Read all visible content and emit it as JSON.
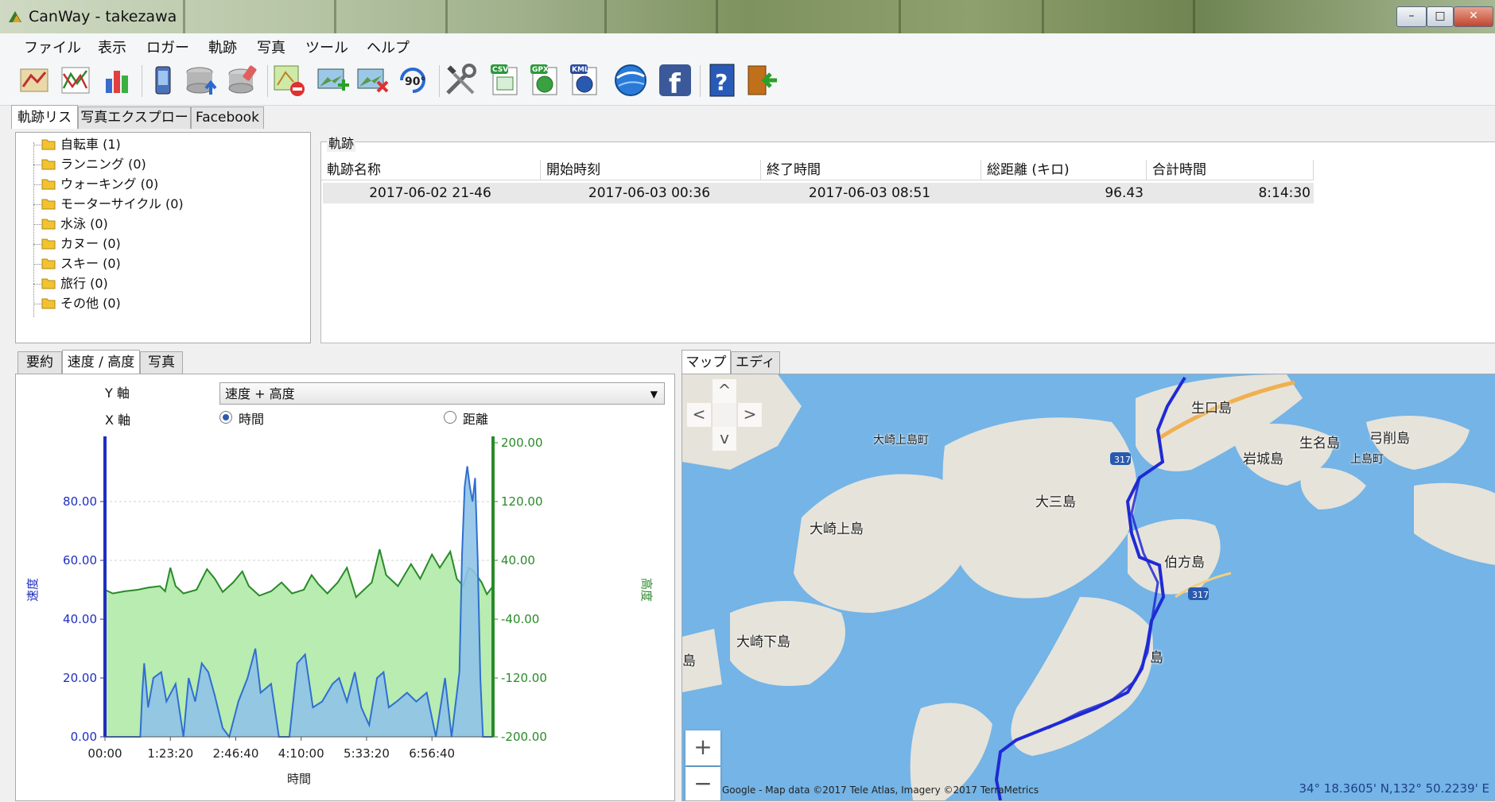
{
  "window": {
    "title": "CanWay - takezawa",
    "min": "–",
    "max": "□",
    "close": "✕"
  },
  "menu": [
    "ファイル",
    "表示",
    "ロガー",
    "軌跡",
    "写真",
    "ツール",
    "ヘルプ"
  ],
  "toolbar_icons": [
    "map-icon",
    "graph-icon",
    "bar-chart-icon",
    "device-icon",
    "database-upload-icon",
    "eraser-icon",
    "delete-track-icon",
    "add-photo-icon",
    "remove-photo-icon",
    "rotate-90-icon",
    "tools-icon",
    "csv-icon",
    "gpx-icon",
    "kml-icon",
    "google-earth-icon",
    "facebook-icon",
    "help-icon",
    "exit-icon"
  ],
  "toolbar": {
    "rotate_text": "90°",
    "csv": "CSV",
    "gpx": "GPX",
    "kml": "KML",
    "facebook": "f",
    "help": "?"
  },
  "top_tabs": [
    "軌跡リスト",
    "写真エクスプローラ",
    "Facebook"
  ],
  "tree": [
    {
      "label": "自転車 (1)"
    },
    {
      "label": "ランニング (0)"
    },
    {
      "label": "ウォーキング (0)"
    },
    {
      "label": "モーターサイクル (0)"
    },
    {
      "label": "水泳 (0)"
    },
    {
      "label": "カヌー (0)"
    },
    {
      "label": "スキー (0)"
    },
    {
      "label": "旅行 (0)"
    },
    {
      "label": "その他 (0)"
    }
  ],
  "tracks": {
    "group_label": "軌跡",
    "columns": [
      "軌跡名称",
      "開始時刻",
      "終了時間",
      "総距離 (キロ)",
      "合計時間"
    ],
    "rows": [
      [
        "2017-06-02 21-46",
        "2017-06-03 00:36",
        "2017-06-03 08:51",
        "96.43",
        "8:14:30"
      ]
    ]
  },
  "bottom_left_tabs": [
    "要約",
    "速度 / 高度",
    "写真"
  ],
  "bottom_right_tabs": [
    "マップ",
    "エディタ"
  ],
  "chart_controls": {
    "y_label": "Y 軸",
    "x_label": "X 軸",
    "y_select": "速度 + 高度",
    "x_option_time": "時間",
    "x_option_distance": "距離"
  },
  "chart_data": {
    "type": "area",
    "x_ticks": [
      "00:00",
      "1:23:20",
      "2:46:40",
      "4:10:00",
      "5:33:20",
      "6:56:40"
    ],
    "xlabel": "時間",
    "y_left": {
      "label": "速度",
      "ticks": [
        "0.00",
        "20.00",
        "40.00",
        "60.00",
        "80.00"
      ],
      "range": [
        0,
        100
      ],
      "color": "#1f2fbf"
    },
    "y_right": {
      "label": "高度",
      "ticks": [
        "-200.00",
        "-120.00",
        "-40.00",
        "40.00",
        "120.00",
        "200.00"
      ],
      "range": [
        -200,
        200
      ],
      "color": "#2a8a2a"
    },
    "x_max_seconds": 29670,
    "series": [
      {
        "name": "高度",
        "axis": "right",
        "color": "#2a8a2a",
        "fill": "#b8ecb0",
        "points": [
          [
            0,
            0
          ],
          [
            600,
            -5
          ],
          [
            1500,
            -2
          ],
          [
            2500,
            0
          ],
          [
            3300,
            3
          ],
          [
            4200,
            5
          ],
          [
            4600,
            -2
          ],
          [
            5000,
            30
          ],
          [
            5400,
            5
          ],
          [
            6000,
            -5
          ],
          [
            7000,
            0
          ],
          [
            7800,
            28
          ],
          [
            8400,
            15
          ],
          [
            9000,
            -3
          ],
          [
            9800,
            10
          ],
          [
            10500,
            25
          ],
          [
            11000,
            5
          ],
          [
            11800,
            -8
          ],
          [
            12700,
            -2
          ],
          [
            13500,
            10
          ],
          [
            14300,
            -5
          ],
          [
            15200,
            0
          ],
          [
            15800,
            20
          ],
          [
            16300,
            8
          ],
          [
            17000,
            -5
          ],
          [
            17800,
            10
          ],
          [
            18500,
            30
          ],
          [
            19200,
            -10
          ],
          [
            20400,
            10
          ],
          [
            21000,
            55
          ],
          [
            21500,
            20
          ],
          [
            22400,
            5
          ],
          [
            23400,
            35
          ],
          [
            24100,
            15
          ],
          [
            25000,
            48
          ],
          [
            25600,
            30
          ],
          [
            26400,
            52
          ],
          [
            26900,
            15
          ],
          [
            27400,
            5
          ],
          [
            27800,
            30
          ],
          [
            28200,
            25
          ],
          [
            28800,
            10
          ],
          [
            29200,
            -6
          ],
          [
            29670,
            5
          ]
        ]
      },
      {
        "name": "速度",
        "axis": "left",
        "color": "#2f6fd0",
        "fill": "#8fc3e8",
        "points": [
          [
            0,
            0
          ],
          [
            2000,
            0
          ],
          [
            2700,
            0
          ],
          [
            2850,
            15
          ],
          [
            3000,
            25
          ],
          [
            3300,
            10
          ],
          [
            3700,
            20
          ],
          [
            4300,
            22
          ],
          [
            4700,
            12
          ],
          [
            5400,
            18
          ],
          [
            6000,
            0
          ],
          [
            6400,
            20
          ],
          [
            6900,
            12
          ],
          [
            7400,
            25
          ],
          [
            7900,
            22
          ],
          [
            8400,
            14
          ],
          [
            9000,
            3
          ],
          [
            9500,
            0
          ],
          [
            10200,
            12
          ],
          [
            10900,
            20
          ],
          [
            11500,
            30
          ],
          [
            11900,
            15
          ],
          [
            12700,
            18
          ],
          [
            13300,
            0
          ],
          [
            14100,
            0
          ],
          [
            14700,
            25
          ],
          [
            15300,
            28
          ],
          [
            15900,
            10
          ],
          [
            16600,
            12
          ],
          [
            17400,
            18
          ],
          [
            17900,
            20
          ],
          [
            18500,
            12
          ],
          [
            19100,
            22
          ],
          [
            19600,
            10
          ],
          [
            20200,
            4
          ],
          [
            20800,
            20
          ],
          [
            21300,
            22
          ],
          [
            21700,
            10
          ],
          [
            22300,
            12
          ],
          [
            23100,
            15
          ],
          [
            23800,
            12
          ],
          [
            24600,
            15
          ],
          [
            25300,
            0
          ],
          [
            26000,
            20
          ],
          [
            26500,
            0
          ],
          [
            27100,
            22
          ],
          [
            27300,
            62
          ],
          [
            27500,
            85
          ],
          [
            27700,
            92
          ],
          [
            27900,
            85
          ],
          [
            28100,
            80
          ],
          [
            28300,
            88
          ],
          [
            28500,
            60
          ],
          [
            28700,
            20
          ],
          [
            28900,
            0
          ],
          [
            29200,
            0
          ],
          [
            29670,
            0
          ]
        ]
      }
    ]
  },
  "map": {
    "attribution": "Google - Map data ©2017 Tele Atlas, Imagery ©2017 TerraMetrics",
    "coords": "34° 18.3605' N,132° 50.2239' E",
    "route_color": "#1f2ad4",
    "places": [
      {
        "id": "ikuchijima",
        "label": "生口島"
      },
      {
        "id": "ikinajima",
        "label": "生名島"
      },
      {
        "id": "yugeshima",
        "label": "弓削島"
      },
      {
        "id": "iwagijima",
        "label": "岩城島"
      },
      {
        "id": "kamijimacho",
        "label": "上島町"
      },
      {
        "id": "osakikamijimacho",
        "label": "大崎上島町"
      },
      {
        "id": "omishima",
        "label": "大三島"
      },
      {
        "id": "osakikamijima",
        "label": "大崎上島"
      },
      {
        "id": "hakatajima",
        "label": "伯方島"
      },
      {
        "id": "osakishimojima",
        "label": "大崎下島"
      },
      {
        "id": "oshima",
        "label": "島"
      },
      {
        "id": "leftshima",
        "label": "島"
      }
    ],
    "road_badges": [
      "317",
      "317"
    ],
    "zoom_in": "+",
    "zoom_out": "−",
    "nav": {
      "up": "^",
      "down": "v",
      "left": "<",
      "right": ">"
    }
  }
}
